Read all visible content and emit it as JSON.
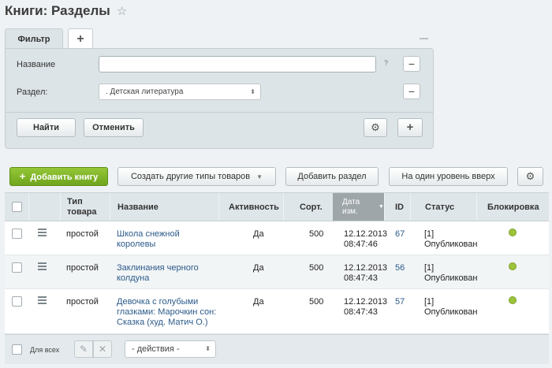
{
  "header": {
    "title": "Книги: Разделы",
    "star_icon": "☆"
  },
  "filter": {
    "tabs": [
      {
        "label": "Фильтр"
      },
      {
        "label": "+"
      }
    ],
    "fields": {
      "name_label": "Название",
      "name_value": "",
      "help": "?",
      "section_label": "Раздел:",
      "section_value": ". Детская литература"
    },
    "buttons": {
      "find": "Найти",
      "cancel": "Отменить"
    }
  },
  "toolbar": {
    "add_book": "Добавить книгу",
    "create_other": "Создать другие типы товаров",
    "add_section": "Добавить раздел",
    "level_up": "На один уровень вверх"
  },
  "grid": {
    "columns": {
      "type": "Тип товара",
      "name": "Название",
      "active": "Активность",
      "sort": "Сорт.",
      "date": "Дата изм.",
      "id": "ID",
      "status": "Статус",
      "lock": "Блокировка"
    },
    "rows": [
      {
        "type": "простой",
        "name": "Школа снежной королевы",
        "active": "Да",
        "sort": "500",
        "date": "12.12.2013",
        "time": "08:47:46",
        "id": "67",
        "status": "[1] Опубликован"
      },
      {
        "type": "простой",
        "name": "Заклинания черного колдуна",
        "active": "Да",
        "sort": "500",
        "date": "12.12.2013",
        "time": "08:47:43",
        "id": "56",
        "status": "[1] Опубликован"
      },
      {
        "type": "простой",
        "name": "Девочка с голубыми глазками: Марочкин сон: Сказка (худ. Матич О.)",
        "active": "Да",
        "sort": "500",
        "date": "12.12.2013",
        "time": "08:47:43",
        "id": "57",
        "status": "[1] Опубликован"
      }
    ],
    "lock_color": "#9cc33b"
  },
  "footer": {
    "for_all": "Для всех",
    "actions": "- действия -"
  }
}
